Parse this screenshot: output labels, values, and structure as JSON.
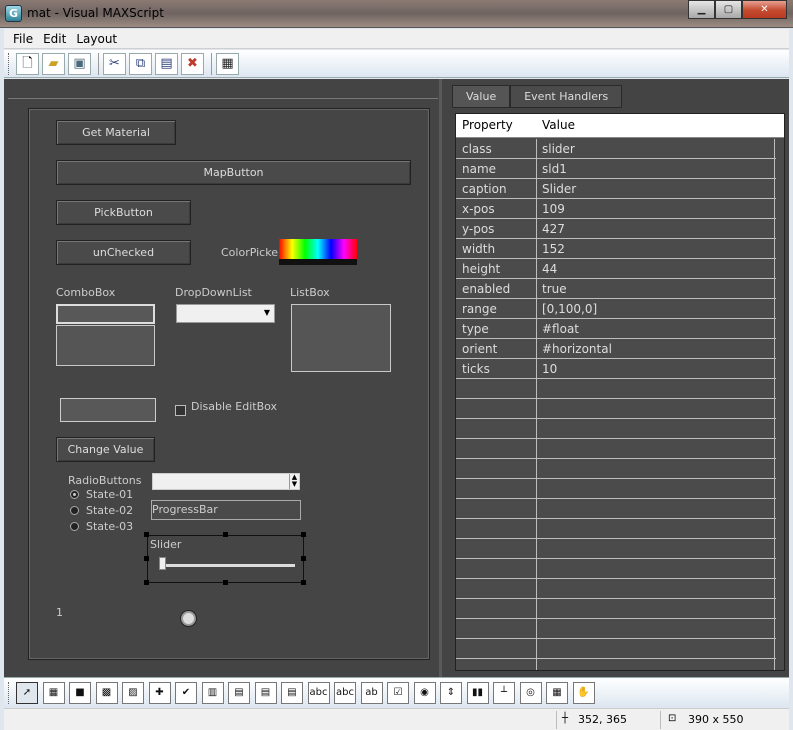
{
  "window": {
    "title": "mat - Visual MAXScript",
    "app_icon_glyph": "G",
    "minimize": "▁",
    "maximize": "▢",
    "close": "✕"
  },
  "menu": [
    "File",
    "Edit",
    "Layout"
  ],
  "toolbar": [
    "new-file-icon",
    "open-folder-icon",
    "save-icon",
    "cut-icon",
    "copy-icon",
    "paste-icon",
    "delete-icon",
    "grid-icon"
  ],
  "form": {
    "get_material": "Get Material",
    "map_button": "MapButton",
    "pick_button": "PickButton",
    "checkbutton": "unChecked",
    "colorpicker_label": "ColorPicker",
    "combobox_label": "ComboBox",
    "dropdown_label": "DropDownList",
    "listbox_label": "ListBox",
    "disable_editbox": "Disable EditBox",
    "change_value": "Change Value",
    "radio_label": "RadioButtons",
    "radio_options": [
      "State-01",
      "State-02",
      "State-03"
    ],
    "progressbar": "ProgressBar",
    "slider": "Slider",
    "label_value": "1",
    "colors": {
      "panel": "#444444",
      "form": "#454545",
      "button": "#4a4a4a"
    }
  },
  "properties": {
    "tabs": [
      "Value",
      "Event Handlers"
    ],
    "header": {
      "property": "Property",
      "value": "Value"
    },
    "rows": [
      {
        "property": "class",
        "value": "slider"
      },
      {
        "property": "name",
        "value": "sld1"
      },
      {
        "property": "caption",
        "value": "Slider"
      },
      {
        "property": "x-pos",
        "value": "109"
      },
      {
        "property": "y-pos",
        "value": "427"
      },
      {
        "property": "width",
        "value": "152"
      },
      {
        "property": "height",
        "value": "44"
      },
      {
        "property": "enabled",
        "value": "true"
      },
      {
        "property": "range",
        "value": "[0,100,0]"
      },
      {
        "property": "type",
        "value": "#float"
      },
      {
        "property": "orient",
        "value": "#horizontal"
      },
      {
        "property": "ticks",
        "value": "10"
      }
    ]
  },
  "palette": [
    "pointer-icon",
    "bitmap-icon",
    "button-icon",
    "mapbutton-icon",
    "materialbutton-icon",
    "pickbutton-icon",
    "checkbutton-icon",
    "colorpicker-icon",
    "combobox-icon",
    "dropdownlist-icon",
    "listbox-icon",
    "edittext-icon",
    "label-icon",
    "groupbox-icon",
    "checkbox-icon",
    "radiobuttons-icon",
    "spinner-icon",
    "progressbar-icon",
    "slider-icon",
    "timer-icon",
    "activex-icon",
    "hyperlink-icon"
  ],
  "palette_glyphs": [
    "➚",
    "▦",
    "■",
    "▩",
    "▨",
    "✚",
    "✔",
    "▥",
    "▤",
    "▤",
    "▤",
    "abc",
    "abc",
    "ab",
    "☑",
    "◉",
    "⇕",
    "▮▮",
    "┴",
    "◎",
    "▦",
    "✋"
  ],
  "status": {
    "position": "352, 365",
    "size": "390 x 550"
  }
}
